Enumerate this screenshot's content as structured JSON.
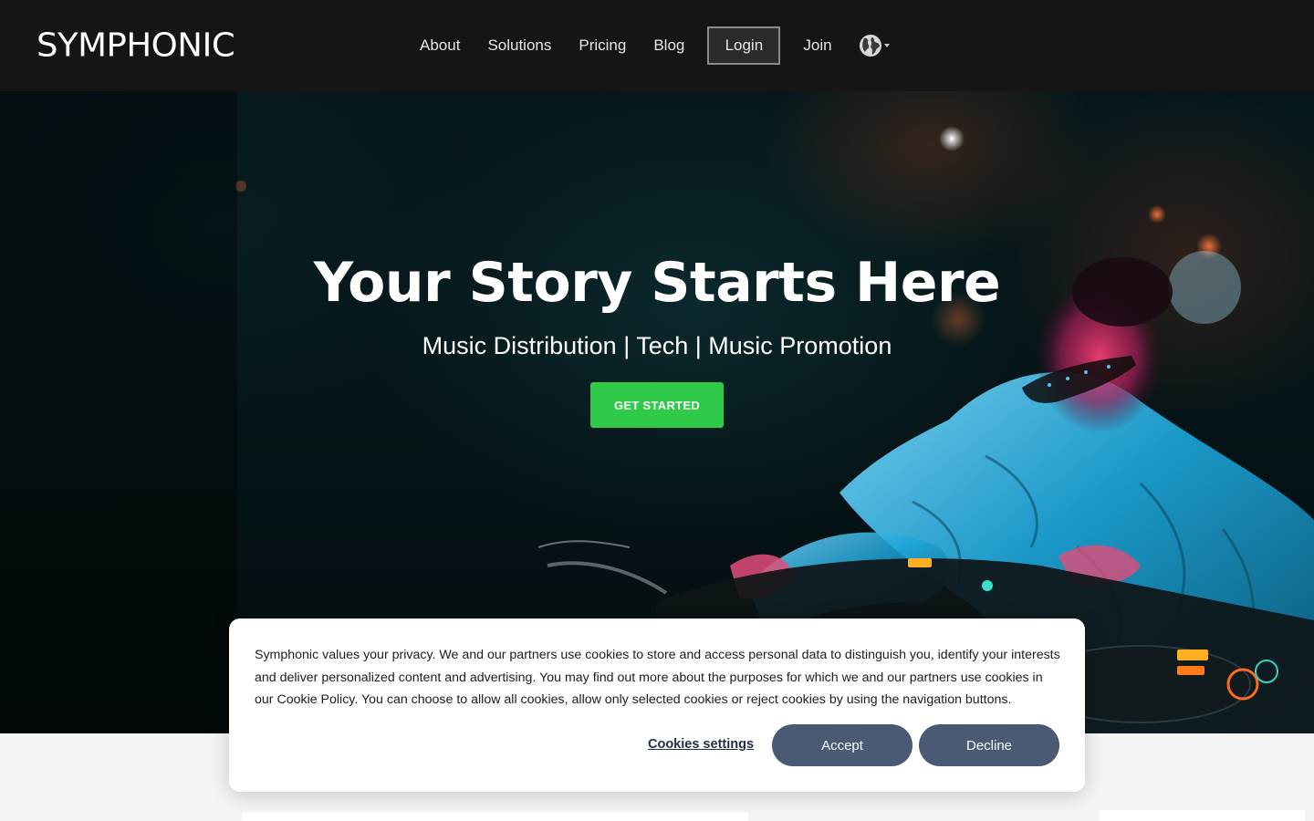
{
  "brand": {
    "logo_text": "SYMPHONIC"
  },
  "nav": {
    "items": [
      {
        "label": "About"
      },
      {
        "label": "Solutions"
      },
      {
        "label": "Pricing"
      },
      {
        "label": "Blog"
      }
    ],
    "login_label": "Login",
    "join_label": "Join",
    "language_icon": "globe-icon"
  },
  "hero": {
    "title": "Your Story Starts Here",
    "subtitle": "Music Distribution | Tech | Music Promotion",
    "cta_label": "GET STARTED",
    "cta_color": "#2fcb48"
  },
  "cookie_banner": {
    "text": "Symphonic values your privacy. We and our partners use cookies to store and access personal data to distinguish you, identify your interests and deliver personalized content and advertising. You may find out more about the purposes for which we and our partners use cookies in our Cookie Policy. You can choose to allow all cookies, allow only selected cookies or reject cookies by using the navigation buttons.",
    "settings_label": "Cookies settings",
    "accept_label": "Accept",
    "decline_label": "Decline",
    "button_color": "#4a5a74"
  },
  "colors": {
    "navbar_bg": "#151515",
    "page_bg": "#f4f4f4"
  }
}
